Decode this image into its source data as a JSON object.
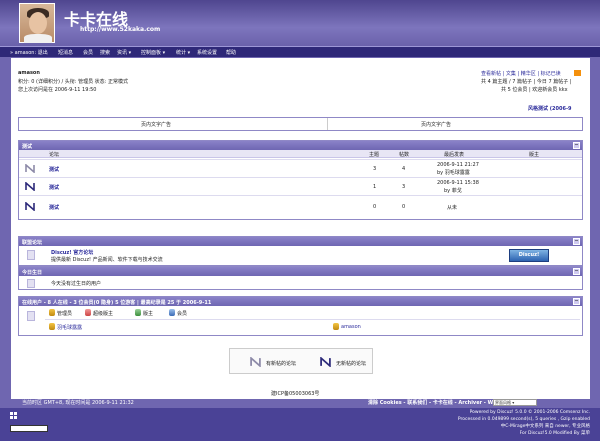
{
  "header": {
    "site_title": "卡卡在线",
    "site_url": "http://www.52kaka.com"
  },
  "nav": {
    "items": [
      {
        "label": "» amason: 退出"
      },
      {
        "label": "短消息"
      },
      {
        "label": "会员"
      },
      {
        "label": "搜索"
      },
      {
        "label": "资讯 ▾"
      },
      {
        "label": "控制面板 ▾"
      },
      {
        "label": "统计 ▾"
      },
      {
        "label": "系统设置"
      },
      {
        "label": "帮助"
      }
    ]
  },
  "user": {
    "name": "amason",
    "line1": "积分: 0 (详细积分) / 头衔: 管理员 状态: 正常模式",
    "line2": "您上次访问是在 2006-9-11 19:50"
  },
  "right_links": {
    "line1": "查看新帖 | 文集 | 精华区 | 标记已读",
    "line2": "共 4 篇主题 / 7 篇帖子 | 今日 7 篇帖子 |",
    "line3": "共 5 位会员 | 欢迎新会员 kkx"
  },
  "announcement": "风格测试 (2006-9",
  "ads": {
    "left": "页内文字广告",
    "right": "页内文字广告"
  },
  "forums_section": {
    "title": "测试",
    "columns": {
      "forum": "论坛",
      "topics": "主题",
      "posts": "帖数",
      "last_post": "最后发表",
      "moderator": "版主"
    },
    "rows": [
      {
        "name": "测试",
        "topics": "3",
        "posts": "4",
        "last_date": "2006-9-11 21:27",
        "last_by": "by 羽毛球露露"
      },
      {
        "name": "测试",
        "topics": "1",
        "posts": "3",
        "last_date": "2006-9-11 15:38",
        "last_by": "by 菲戈"
      },
      {
        "name": "测试",
        "topics": "0",
        "posts": "0",
        "last_date": "从未",
        "last_by": ""
      }
    ]
  },
  "links_section": {
    "title": "联盟论坛",
    "link_name": "Discuz! 官方论坛",
    "link_desc": "提供最新 Discuz! 产品新闻、软件下载与技术交流",
    "logo_text": "Discuz!"
  },
  "birthday_section": {
    "title": "今日生日",
    "text": "今天没有过生日的用户"
  },
  "online_section": {
    "title": "在线用户 - 8 人在线 - 3 位会员(0 隐身) 5 位游客 | 最高纪录是 25 于 2006-9-11",
    "legend": [
      "管理员",
      "超级版主",
      "版主",
      "会员"
    ],
    "users": [
      "羽毛球露露",
      "amason"
    ]
  },
  "legend": {
    "new": "有新帖的论坛",
    "nonew": "无新帖的论坛"
  },
  "icp": "建ICP备05003063号",
  "footer": {
    "time": "当前时区 GMT+8, 现在时间是 2006-9-11 21:32",
    "links": "清除 Cookies - 联系我们 - 卡卡在线 - Archiver - WAP",
    "style_select": "界面风格",
    "powered_lines": [
      "Powered by Discuz! 5.0.0 © 2001-2006 Comsenz Inc.",
      "Processed in 0.049899 second(s), 5 queries , Gzip enabled",
      "中C-Mirage中文系列 来自 newer, 专业风格",
      "For Discuz!5.0 Modified By 菜单"
    ]
  },
  "colors": {
    "background": "#6f66b0",
    "nav": "#2e2878",
    "section_head": "#8a82c8"
  }
}
